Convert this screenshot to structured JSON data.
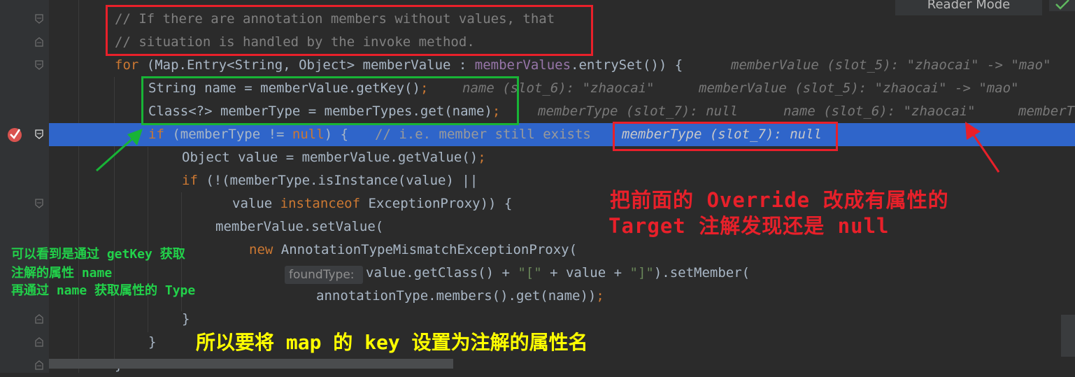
{
  "toolbar": {
    "reader_mode_label": "Reader Mode",
    "check_icon": "check-icon"
  },
  "code": {
    "comment1": "// If there are annotation members without values, that",
    "comment2": "// situation is handled by the invoke method.",
    "l3": {
      "kw_for": "for",
      "p1": " (Map.Entry<String, Object> memberValue : ",
      "field": "memberValues",
      "p2": ".entrySet()) {",
      "hint": "memberValue (slot_5): \"zhaocai\" -> \"mao\""
    },
    "l4": {
      "code": "String name = memberValue.getKey()",
      "semi": ";",
      "hint1": "name (slot_6): \"zhaocai\"",
      "hint2": "memberValue (slot_5): \"zhaocai\" -> \"mao\""
    },
    "l5": {
      "code": "Class<?> memberType = memberTypes.get(name)",
      "semi": ";",
      "hint1": "memberType (slot_7): null",
      "hint2": "name (slot_6): \"zhaocai\"",
      "hint3": "memberT"
    },
    "l6": {
      "kw_if": "if",
      "p1": " (memberType != ",
      "kw_null": "null",
      "p2": ") {",
      "comment": "// i.e. member still exists",
      "hint": "memberType (slot_7): null"
    },
    "l7": {
      "code": "Object value = memberValue.getValue()",
      "semi": ";"
    },
    "l8": {
      "kw_if": "if",
      "code": " (!(memberType.isInstance(value) ||"
    },
    "l9": {
      "p1": "value ",
      "kw": "instanceof",
      "p2": " ExceptionProxy)) {"
    },
    "l10": {
      "code": "memberValue.setValue("
    },
    "l11": {
      "kw_new": "new",
      "code": " AnnotationTypeMismatchExceptionProxy("
    },
    "l12": {
      "inlay": "foundType:",
      "p1": "value.getClass() + ",
      "s1": "\"[\"",
      "p2": " + value + ",
      "s2": "\"]\"",
      "p3": ").setMember("
    },
    "l13": {
      "code": "annotationType.members().get(name))",
      "semi": ";"
    },
    "l14": "}",
    "l15": "}",
    "l16": "}"
  },
  "annotations": {
    "red_note_line1": "把前面的 Override 改成有属性的",
    "red_note_line2": "Target 注解发现还是 null",
    "green_note_line1": "可以看到是通过 getKey 获取",
    "green_note_line2": "注解的属性 name",
    "green_note_line3": "再通过 name 获取属性的 Type",
    "yellow_note": "所以要将 map 的 key 设置为注解的属性名"
  },
  "colors": {
    "background": "#2b2b2b",
    "highlight": "#2f65ca",
    "keyword": "#cc7832",
    "string": "#6a8759",
    "field": "#9876aa",
    "comment": "#808080",
    "red_annotation": "#e8202a",
    "green_annotation": "#18b436",
    "yellow_annotation": "#ffff00"
  }
}
